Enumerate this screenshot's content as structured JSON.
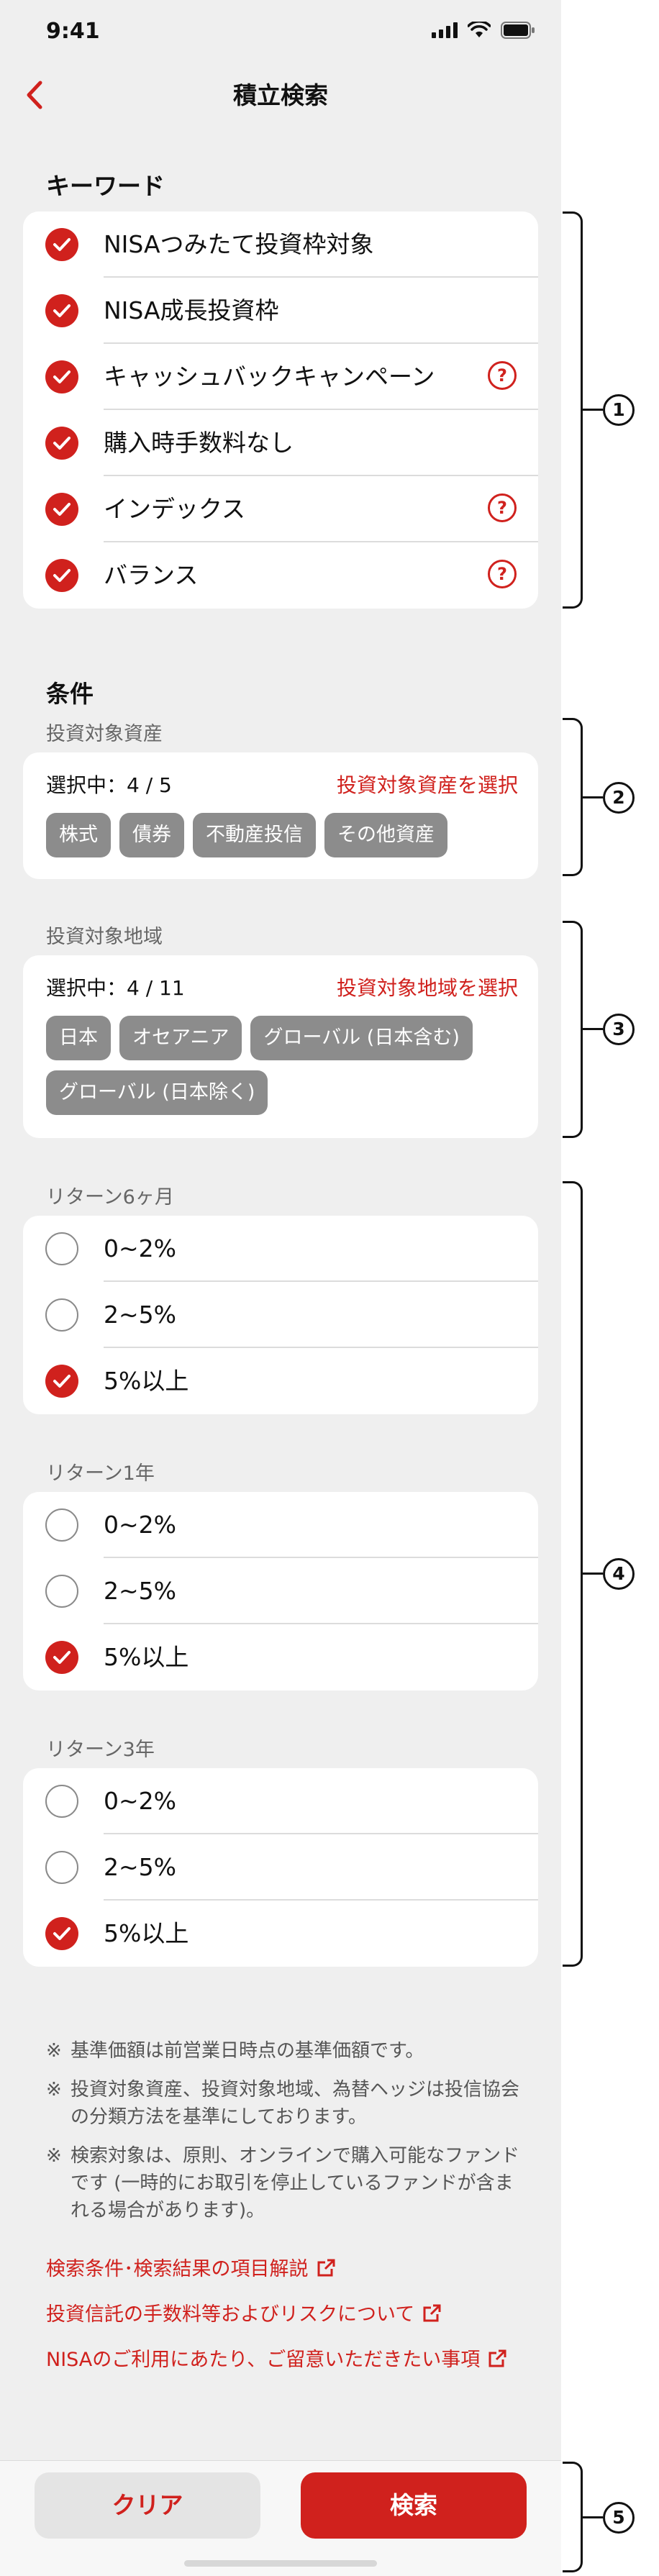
{
  "status_bar": {
    "time": "9:41"
  },
  "nav": {
    "title": "積立検索"
  },
  "keyword_section": {
    "title": "キーワード",
    "items": [
      {
        "label": "NISAつみたて投資枠対象",
        "checked": true
      },
      {
        "label": "NISA成長投資枠",
        "checked": true
      },
      {
        "label": "キャッシュバックキャンペーン",
        "checked": true,
        "help": "?"
      },
      {
        "label": "購入時手数料なし",
        "checked": true
      },
      {
        "label": "インデックス",
        "checked": true,
        "help": "?"
      },
      {
        "label": "バランス",
        "checked": true,
        "help": "?"
      }
    ]
  },
  "condition_section": {
    "title": "条件",
    "asset": {
      "label": "投資対象資産",
      "count": "選択中：4 / 5",
      "link": "投資対象資産を選択",
      "chips": [
        "株式",
        "債券",
        "不動産投信",
        "その他資産"
      ]
    },
    "region": {
      "label": "投資対象地域",
      "count": "選択中：4 / 11",
      "link": "投資対象地域を選択",
      "chips": [
        "日本",
        "オセアニア",
        "グローバル (日本含む)",
        "グローバル (日本除く)"
      ]
    }
  },
  "returns": [
    {
      "label": "リターン6ヶ月",
      "options": [
        {
          "label": "0~2%",
          "selected": false
        },
        {
          "label": "2~5%",
          "selected": false
        },
        {
          "label": "5%以上",
          "selected": true
        }
      ]
    },
    {
      "label": "リターン1年",
      "options": [
        {
          "label": "0~2%",
          "selected": false
        },
        {
          "label": "2~5%",
          "selected": false
        },
        {
          "label": "5%以上",
          "selected": true
        }
      ]
    },
    {
      "label": "リターン3年",
      "options": [
        {
          "label": "0~2%",
          "selected": false
        },
        {
          "label": "2~5%",
          "selected": false
        },
        {
          "label": "5%以上",
          "selected": true
        }
      ]
    }
  ],
  "notes": {
    "mark": "※",
    "items": [
      "基準価額は前営業日時点の基準価額です。",
      "投資対象資産、投資対象地域、為替ヘッジは投信協会の分類方法を基準にしております。",
      "検索対象は、原則、オンラインで購入可能なファンドです (一時的にお取引を停止しているファンドが含まれる場合があります)。"
    ]
  },
  "links": [
    "検索条件･検索結果の項目解説",
    "投資信託の手数料等およびリスクについて",
    "NISAのご利用にあたり、ご留意いただきたい事項"
  ],
  "buttons": {
    "clear": "クリア",
    "search": "検索"
  },
  "annotations": [
    "1",
    "2",
    "3",
    "4",
    "5"
  ],
  "colors": {
    "accent": "#d0211d",
    "chip": "#8c8c8c",
    "background": "#efefef"
  },
  "icons": {
    "check": "check-icon",
    "help": "question-circle-icon",
    "external": "external-link-icon",
    "back": "chevron-left-icon"
  }
}
